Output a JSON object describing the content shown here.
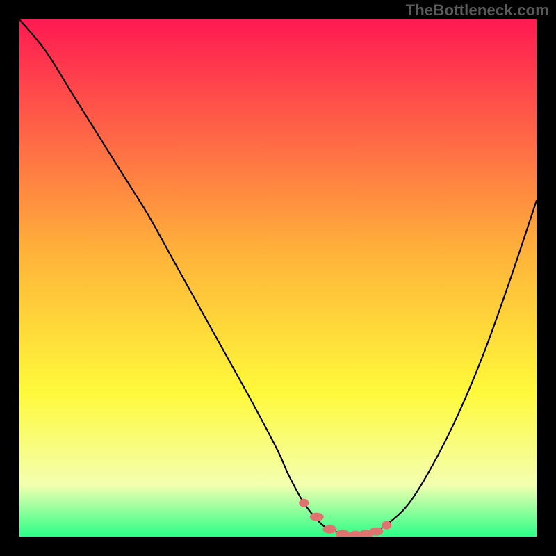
{
  "watermark": "TheBottleneck.com",
  "colors": {
    "background_black": "#000000",
    "gradient_top": "#ff1a52",
    "gradient_mid1": "#ffb23a",
    "gradient_mid2": "#fff93a",
    "gradient_bottom1": "#f3ffb0",
    "gradient_bottom2": "#2cff88",
    "curve": "#000000",
    "marker": "#e0726f"
  },
  "chart_data": {
    "type": "line",
    "title": "",
    "xlabel": "",
    "ylabel": "",
    "xlim": [
      0,
      100
    ],
    "ylim": [
      0,
      100
    ],
    "series": [
      {
        "name": "bottleneck-curve",
        "x": [
          0,
          5,
          10,
          15,
          20,
          25,
          30,
          35,
          40,
          45,
          50,
          52,
          55,
          58,
          60,
          62,
          65,
          68,
          70,
          75,
          80,
          85,
          90,
          95,
          100
        ],
        "y": [
          100,
          94,
          86,
          78,
          70,
          62,
          53,
          44,
          35,
          26,
          16.5,
          12,
          6.5,
          2.8,
          1.4,
          0.7,
          0.3,
          0.7,
          1.6,
          6,
          14,
          24,
          36,
          50,
          65
        ]
      }
    ],
    "markers": {
      "name": "optimal-range",
      "x": [
        55,
        57.5,
        60,
        62.5,
        65,
        67,
        69,
        71
      ],
      "y": [
        6.5,
        3.8,
        1.4,
        0.5,
        0.3,
        0.5,
        1.0,
        2.2
      ]
    },
    "annotations": [],
    "legend": []
  }
}
